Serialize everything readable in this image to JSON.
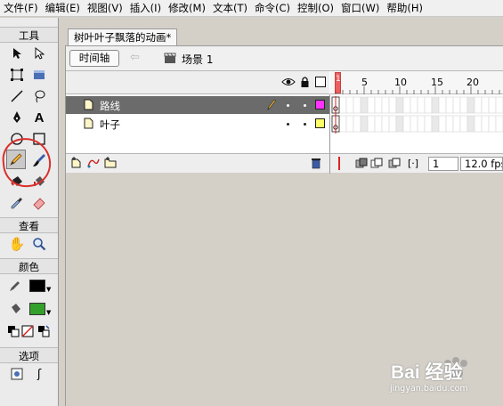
{
  "menubar": {
    "items": [
      "文件(F)",
      "编辑(E)",
      "视图(V)",
      "插入(I)",
      "修改(M)",
      "文本(T)",
      "命令(C)",
      "控制(O)",
      "窗口(W)",
      "帮助(H)"
    ]
  },
  "toolbox": {
    "tools_title": "工具",
    "view_title": "查看",
    "colors_title": "颜色",
    "options_title": "选项",
    "stroke_color": "#000000",
    "fill_color": "#33a02c"
  },
  "document": {
    "tab_title": "树叶叶子飘落的动画*",
    "timeline_button": "时间轴",
    "scene_label": "场景 1"
  },
  "timeline": {
    "ruler_marks": [
      "1",
      "5",
      "10",
      "15",
      "20"
    ],
    "layers": [
      {
        "name": "路线",
        "selected": true,
        "color": "#ff33ff"
      },
      {
        "name": "叶子",
        "selected": false,
        "color": "#ffff66"
      }
    ],
    "current_frame": "1",
    "frame_rate": "12.0 fps"
  },
  "watermark": {
    "brand_text": "Bai 经验",
    "url": "jingyan.baidu.com"
  }
}
